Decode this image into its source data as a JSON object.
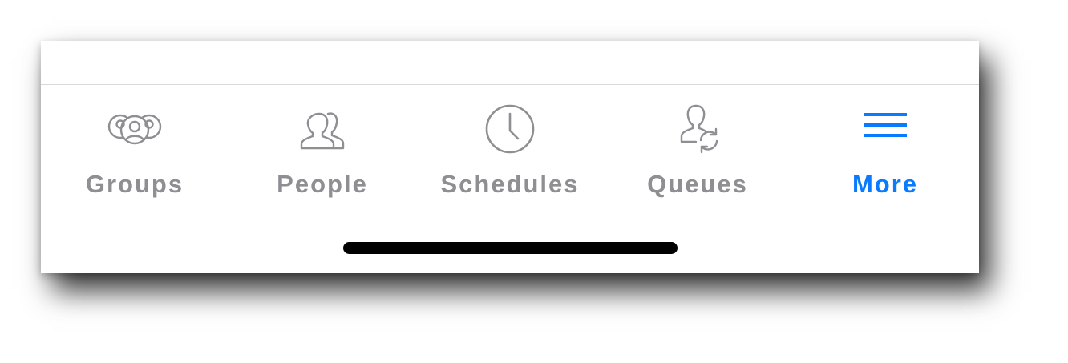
{
  "tabbar": {
    "tabs": [
      {
        "id": "groups",
        "label": "Groups",
        "icon": "groups-icon",
        "active": false
      },
      {
        "id": "people",
        "label": "People",
        "icon": "people-icon",
        "active": false
      },
      {
        "id": "schedules",
        "label": "Schedules",
        "icon": "clock-icon",
        "active": false
      },
      {
        "id": "queues",
        "label": "Queues",
        "icon": "queue-person-sync-icon",
        "active": false
      },
      {
        "id": "more",
        "label": "More",
        "icon": "hamburger-menu-icon",
        "active": true
      }
    ]
  },
  "colors": {
    "inactive": "#8e8e93",
    "active": "#0a7aff",
    "home_indicator": "#000000"
  }
}
